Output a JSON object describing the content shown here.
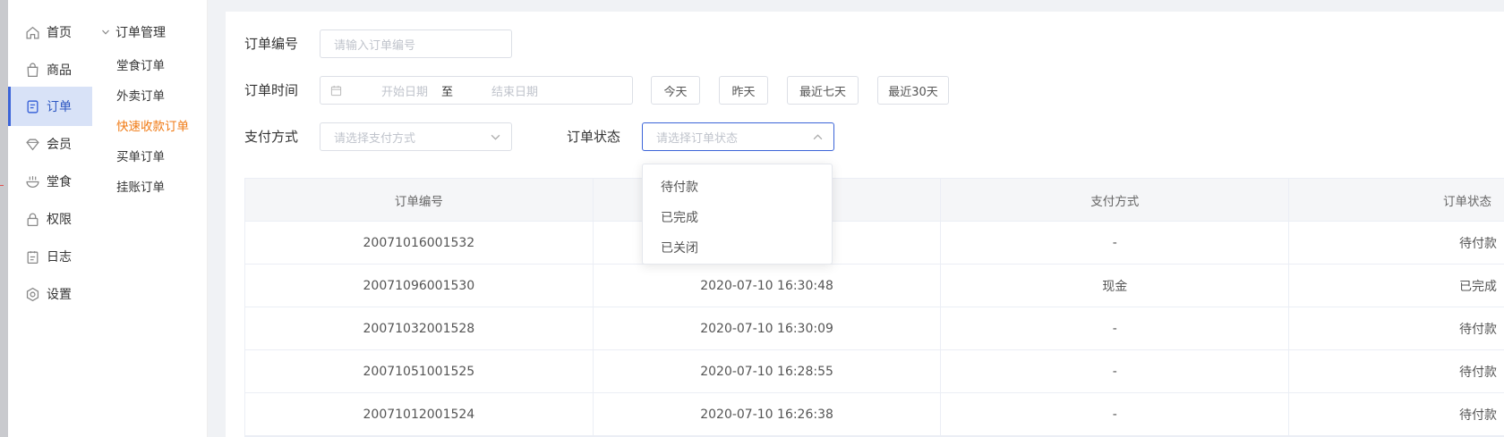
{
  "nav": {
    "items": [
      {
        "label": "首页",
        "icon": "home-icon"
      },
      {
        "label": "商品",
        "icon": "shopping-bag-icon"
      },
      {
        "label": "订单",
        "icon": "document-icon",
        "active": true
      },
      {
        "label": "会员",
        "icon": "diamond-icon"
      },
      {
        "label": "堂食",
        "icon": "bowl-icon"
      },
      {
        "label": "权限",
        "icon": "lock-icon"
      },
      {
        "label": "日志",
        "icon": "clipboard-icon"
      },
      {
        "label": "设置",
        "icon": "settings-icon"
      }
    ]
  },
  "subnav": {
    "title": "订单管理",
    "items": [
      "堂食订单",
      "外卖订单",
      "快速收款订单",
      "买单订单",
      "挂账订单"
    ],
    "active_index": 2
  },
  "filters": {
    "order_no_label": "订单编号",
    "order_no_placeholder": "请输入订单编号",
    "order_time_label": "订单时间",
    "start_placeholder": "开始日期",
    "range_sep": "至",
    "end_placeholder": "结束日期",
    "quick_buttons": [
      "今天",
      "昨天",
      "最近七天",
      "最近30天"
    ],
    "pay_method_label": "支付方式",
    "pay_method_placeholder": "请选择支付方式",
    "status_label": "订单状态",
    "status_placeholder": "请选择订单状态"
  },
  "dropdown": {
    "options": [
      "待付款",
      "已完成",
      "已关闭"
    ]
  },
  "table": {
    "headers": [
      "订单编号",
      "",
      "支付方式",
      "订单状态"
    ],
    "rows": [
      [
        "20071016001532",
        "",
        "-",
        "待付款"
      ],
      [
        "20071096001530",
        "2020-07-10 16:30:48",
        "现金",
        "已完成"
      ],
      [
        "20071032001528",
        "2020-07-10 16:30:09",
        "-",
        "待付款"
      ],
      [
        "20071051001525",
        "2020-07-10 16:28:55",
        "-",
        "待付款"
      ],
      [
        "20071012001524",
        "2020-07-10 16:26:38",
        "-",
        "待付款"
      ]
    ]
  },
  "colors": {
    "accent": "#3b64d8",
    "active_sub": "#f07a14",
    "nav_active_bg": "#d8e2f7"
  }
}
